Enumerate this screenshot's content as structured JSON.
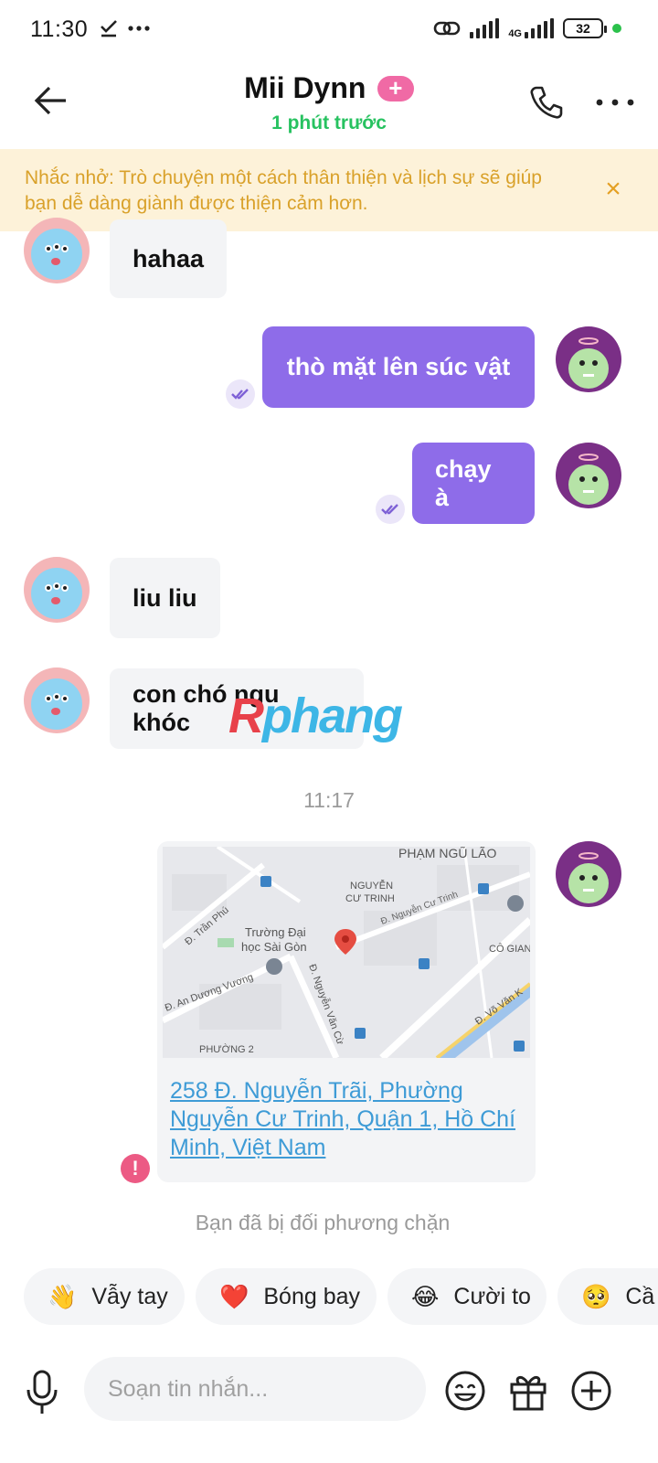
{
  "status_bar": {
    "time": "11:30",
    "network": "4G",
    "battery": "32"
  },
  "header": {
    "title": "Mii Dynn",
    "plus_badge": "+",
    "subtitle": "1 phút trước"
  },
  "banner": {
    "text": "Nhắc nhở: Trò chuyện một cách thân thiện và lịch sự sẽ giúp bạn dễ dàng giành được thiện cảm hơn.",
    "close": "×"
  },
  "messages": [
    {
      "direction": "in",
      "text": "hahaa"
    },
    {
      "direction": "out",
      "text": "thò mặt lên súc vật"
    },
    {
      "direction": "out",
      "text": "chạy à"
    },
    {
      "direction": "in",
      "text": "liu liu"
    },
    {
      "direction": "in",
      "text": "con chó ngu khóc"
    }
  ],
  "time_separator": "11:17",
  "location": {
    "address": "258 Đ. Nguyễn Trãi, Phường Nguyễn Cư Trinh, Quận 1, Hồ Chí Minh, Việt Nam",
    "map_labels": {
      "pham_ngu_lao": "PHẠM NGŨ LÃO",
      "nguyen_cu_trinh_1": "NGUYỄN",
      "nguyen_cu_trinh_2": "CƯ TRINH",
      "duong_nct": "Đ. Nguyễn Cư Trinh",
      "tran_phu": "Đ. Trần Phú",
      "truong_1": "Trường Đại",
      "truong_2": "học Sài Gòn",
      "co_giang": "CÔ GIAN",
      "an_duong_vuong": "Đ. An Dương Vương",
      "nguyen_van_cu": "Đ. Nguyễn Văn Cừ",
      "vo_van_kiet": "Đ. Võ Văn K",
      "phuong_2": "PHƯỜNG 2"
    }
  },
  "error_badge": "!",
  "blocked_notice": "Bạn đã bị đối phương chặn",
  "watermark": {
    "part1": "R",
    "part2": "phang"
  },
  "chips": [
    {
      "emoji": "👋",
      "label": "Vẫy tay"
    },
    {
      "emoji": "❤️",
      "label": "Bóng bay"
    },
    {
      "emoji": "😂",
      "label": "Cười to"
    },
    {
      "emoji": "🥺",
      "label": "Cầ"
    }
  ],
  "input": {
    "placeholder": "Soạn tin nhắn..."
  },
  "colors": {
    "accent_purple": "#8e6ce9",
    "online_green": "#27c260",
    "banner_bg": "#fdf2d9",
    "banner_text": "#d9a12a",
    "link_blue": "#3e9bd6"
  }
}
